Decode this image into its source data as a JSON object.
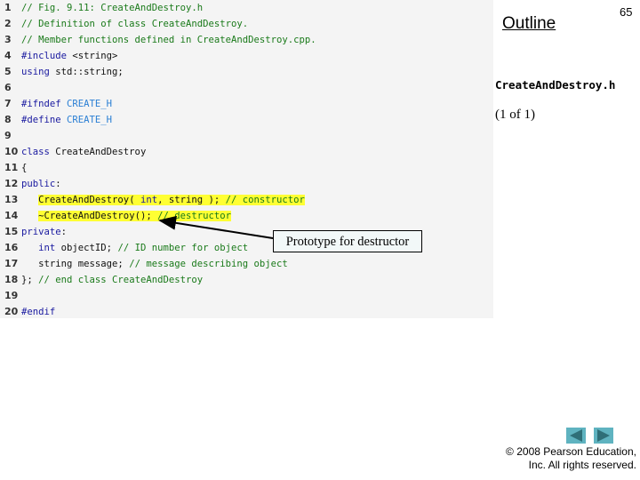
{
  "slide": {
    "page_number": "65",
    "outline_label": "Outline",
    "file_label": "CreateAndDestroy.h",
    "page_count": "(1 of 1)",
    "callout": "Prototype for destructor",
    "copyright_line1": "© 2008 Pearson Education,",
    "copyright_line2": "Inc.  All rights reserved.",
    "nav": {
      "prev_icon": "triangle-left-icon",
      "next_icon": "triangle-right-icon"
    },
    "highlight_color": "#ffff33"
  },
  "code": {
    "lines": [
      {
        "n": "1",
        "parts": [
          {
            "t": "// Fig. 9.11: CreateAndDestroy.h",
            "c": "cm"
          }
        ]
      },
      {
        "n": "2",
        "parts": [
          {
            "t": "// Definition of class CreateAndDestroy.",
            "c": "cm"
          }
        ]
      },
      {
        "n": "3",
        "parts": [
          {
            "t": "// Member functions defined in CreateAndDestroy.cpp.",
            "c": "cm"
          }
        ]
      },
      {
        "n": "4",
        "parts": [
          {
            "t": "#include",
            "c": "pp"
          },
          {
            "t": " <string>",
            "c": "tx"
          }
        ]
      },
      {
        "n": "5",
        "parts": [
          {
            "t": "using",
            "c": "kw"
          },
          {
            "t": " std::string;",
            "c": "tx"
          }
        ]
      },
      {
        "n": "6",
        "parts": []
      },
      {
        "n": "7",
        "parts": [
          {
            "t": "#ifndef",
            "c": "pp"
          },
          {
            "t": " CREATE_H",
            "c": "mac"
          }
        ]
      },
      {
        "n": "8",
        "parts": [
          {
            "t": "#define",
            "c": "pp"
          },
          {
            "t": " CREATE_H",
            "c": "mac"
          }
        ]
      },
      {
        "n": "9",
        "parts": []
      },
      {
        "n": "10",
        "parts": [
          {
            "t": "class",
            "c": "kw"
          },
          {
            "t": " CreateAndDestroy",
            "c": "tx"
          }
        ]
      },
      {
        "n": "11",
        "parts": [
          {
            "t": "{",
            "c": "tx"
          }
        ]
      },
      {
        "n": "12",
        "parts": [
          {
            "t": "public",
            "c": "kw"
          },
          {
            "t": ":",
            "c": "tx"
          }
        ]
      },
      {
        "n": "13",
        "hl": true,
        "parts": [
          {
            "t": "   ",
            "c": "tx",
            "nohl": true
          },
          {
            "t": "CreateAndDestroy( ",
            "c": "tx"
          },
          {
            "t": "int",
            "c": "kw"
          },
          {
            "t": ", string ); ",
            "c": "tx"
          },
          {
            "t": "// constructor",
            "c": "cm"
          }
        ]
      },
      {
        "n": "14",
        "hl": true,
        "parts": [
          {
            "t": "   ",
            "c": "tx",
            "nohl": true
          },
          {
            "t": "~CreateAndDestroy(); ",
            "c": "tx"
          },
          {
            "t": "// destructor",
            "c": "cm"
          }
        ]
      },
      {
        "n": "15",
        "parts": [
          {
            "t": "private",
            "c": "kw"
          },
          {
            "t": ":",
            "c": "tx"
          }
        ]
      },
      {
        "n": "16",
        "parts": [
          {
            "t": "   ",
            "c": "tx"
          },
          {
            "t": "int",
            "c": "kw"
          },
          {
            "t": " objectID; ",
            "c": "tx"
          },
          {
            "t": "// ID number for object",
            "c": "cm"
          }
        ]
      },
      {
        "n": "17",
        "parts": [
          {
            "t": "   string message; ",
            "c": "tx"
          },
          {
            "t": "// message describing object",
            "c": "cm"
          }
        ]
      },
      {
        "n": "18",
        "parts": [
          {
            "t": "}; ",
            "c": "tx"
          },
          {
            "t": "// end class CreateAndDestroy",
            "c": "cm"
          }
        ]
      },
      {
        "n": "19",
        "parts": []
      },
      {
        "n": "20",
        "parts": [
          {
            "t": "#endif",
            "c": "pp"
          }
        ]
      }
    ]
  }
}
